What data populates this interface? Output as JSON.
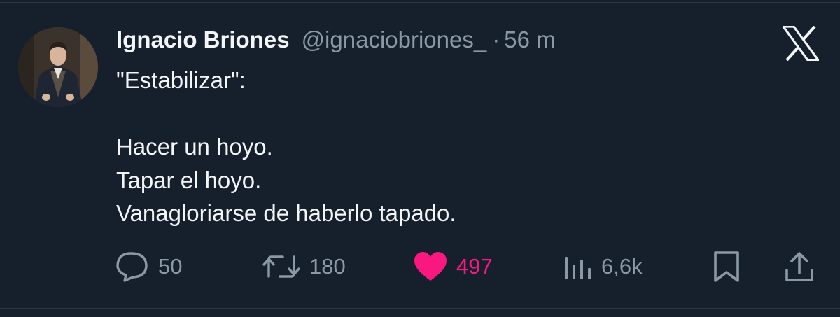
{
  "tweet": {
    "author_name": "Ignacio Briones",
    "handle": "@ignaciobriones_",
    "separator": "·",
    "time": "56 m",
    "text_lines": [
      "\"Estabilizar\":",
      "",
      "Hacer un hoyo.",
      "Tapar el hoyo.",
      "Vanagloriarse de haberlo tapado."
    ]
  },
  "actions": {
    "replies": "50",
    "retweets": "180",
    "likes": "497",
    "views": "6,6k"
  },
  "icons": {
    "reply": "speech-bubble-icon",
    "retweet": "retweet-arrows-icon",
    "like": "heart-icon",
    "views": "bar-chart-icon",
    "bookmark": "bookmark-icon",
    "share": "share-upload-icon",
    "logo": "x-logo-icon"
  },
  "colors": {
    "background": "#16202d",
    "text": "#f3f5f7",
    "muted": "#8b98a5",
    "like": "#f91880"
  }
}
